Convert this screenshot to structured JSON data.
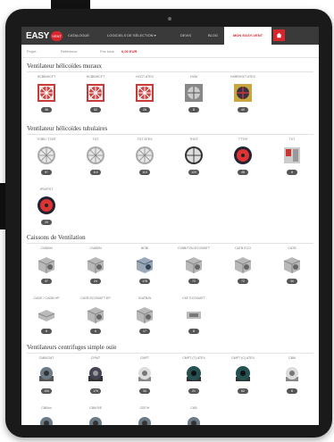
{
  "nav": {
    "logo_text": "EASY",
    "logo_badge": "VENT",
    "items": [
      {
        "label": "CATALOGUE"
      },
      {
        "label": "LOGICIELS DE SÉLECTION ▾"
      },
      {
        "label": "DEVIS"
      },
      {
        "label": "BLOG"
      }
    ],
    "highlight": "MON EASY-VENT",
    "home_icon": "home-icon"
  },
  "subbar": {
    "projet": "Projet",
    "reference": "Référence",
    "prix_label": "Prix total",
    "prix_value": "0,00 EUR"
  },
  "sections": [
    {
      "title": "Ventilateur hélicoïdes muraux",
      "products": [
        {
          "label": "HCBB/HCFT",
          "badge": "36",
          "type": "fan-square"
        },
        {
          "label": "HCBB/HCFT",
          "badge": "52",
          "type": "fan-square"
        },
        {
          "label": "HCGT ATEX",
          "badge": "26",
          "type": "fan-square"
        },
        {
          "label": "HXM",
          "badge": "8",
          "type": "fan-square-gray"
        },
        {
          "label": "HXBR/HXT ATEX",
          "badge": "40",
          "type": "fan-square-yellow"
        }
      ]
    },
    {
      "title": "Ventilateur hélicoïdes tubulaires",
      "products": [
        {
          "label": "TCBB / TCBT",
          "badge": "97",
          "type": "fan-round"
        },
        {
          "label": "TGT",
          "badge": "110",
          "type": "fan-round"
        },
        {
          "label": "TGT ATEX",
          "badge": "110",
          "type": "fan-round"
        },
        {
          "label": "THGT",
          "badge": "120",
          "type": "fan-round-dark"
        },
        {
          "label": "TTT/H",
          "badge": "48",
          "type": "fan-round-red"
        },
        {
          "label": "TXT",
          "badge": "8",
          "type": "fan-box"
        },
        {
          "label": "IPX/IPXT",
          "badge": "20",
          "type": "fan-round-red"
        }
      ]
    },
    {
      "title": "Caissons de Ventilation",
      "products": [
        {
          "label": "CVAB/N",
          "badge": "37",
          "type": "box"
        },
        {
          "label": "CVAB/N",
          "badge": "24",
          "type": "box"
        },
        {
          "label": "NCBI",
          "badge": "178",
          "type": "box-blue"
        },
        {
          "label": "CVAB/TVN ECOWATT",
          "badge": "72",
          "type": "box"
        },
        {
          "label": "CATB ECO",
          "badge": "72",
          "type": "box"
        },
        {
          "label": "CATB",
          "badge": "30",
          "type": "box"
        },
        {
          "label": "CADE / CADB HP",
          "badge": "8",
          "type": "box-flat"
        },
        {
          "label": "CATB ECOWATT EP",
          "badge": "6",
          "type": "box"
        },
        {
          "label": "IGATB/N",
          "badge": "17",
          "type": "box"
        },
        {
          "label": "CKF ECOWATT",
          "badge": "8",
          "type": "box-small"
        }
      ]
    },
    {
      "title": "Ventilateurs centrifuges simple ouïe",
      "products": [
        {
          "label": "CMB/CMT",
          "badge": "100",
          "type": "centrifugal"
        },
        {
          "label": "CPMT",
          "badge": "179",
          "type": "centrifugal-dark"
        },
        {
          "label": "CMPT",
          "badge": "34",
          "type": "centrifugal-white"
        },
        {
          "label": "CMPT (T) ATEX",
          "badge": "21",
          "type": "centrifugal-teal"
        },
        {
          "label": "CMPT (C) ATEX",
          "badge": "62",
          "type": "centrifugal-teal"
        },
        {
          "label": "CBM",
          "badge": "8",
          "type": "centrifugal-white"
        },
        {
          "label": "CBB/m",
          "badge": "",
          "type": "centrifugal"
        },
        {
          "label": "CBM RE",
          "badge": "",
          "type": "centrifugal"
        },
        {
          "label": "CBT/H",
          "badge": "",
          "type": "centrifugal"
        },
        {
          "label": "CKB",
          "badge": "",
          "type": "centrifugal"
        }
      ]
    }
  ],
  "colors": {
    "accent": "#d8262e",
    "nav_bg": "#3a3a3a",
    "badge": "#555555"
  }
}
